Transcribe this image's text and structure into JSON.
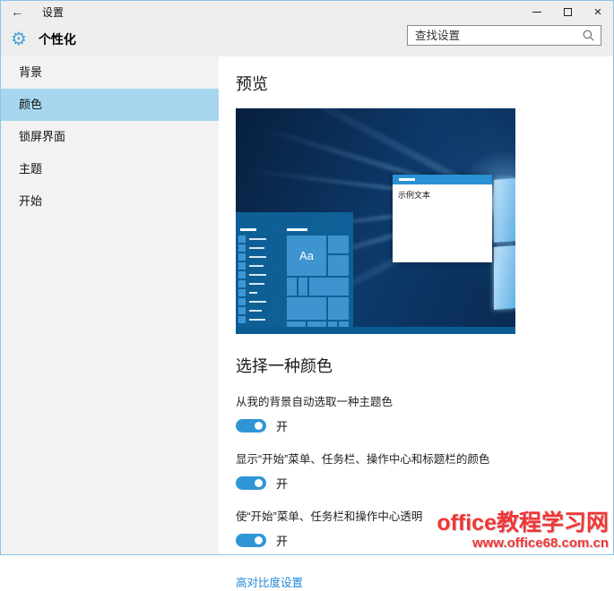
{
  "window": {
    "title": "设置",
    "back_icon": "←",
    "close_icon": "×"
  },
  "header": {
    "page_title": "个性化",
    "gear_icon": "⚙",
    "search_placeholder": "查找设置"
  },
  "sidebar": {
    "items": [
      {
        "label": "背景",
        "selected": false
      },
      {
        "label": "颜色",
        "selected": true
      },
      {
        "label": "锁屏界面",
        "selected": false
      },
      {
        "label": "主题",
        "selected": false
      },
      {
        "label": "开始",
        "selected": false
      }
    ]
  },
  "main": {
    "preview_heading": "预览",
    "preview": {
      "sample_window_text": "示例文本",
      "tile_label": "Aa"
    },
    "section_heading": "选择一种颜色",
    "toggles": [
      {
        "label": "从我的背景自动选取一种主题色",
        "state": "开",
        "on": true
      },
      {
        "label": "显示“开始”菜单、任务栏、操作中心和标题栏的颜色",
        "state": "开",
        "on": true
      },
      {
        "label": "使“开始”菜单、任务栏和操作中心透明",
        "state": "开",
        "on": true
      }
    ],
    "link_label": "高对比度设置"
  },
  "watermark": {
    "line1": "office教程学习网",
    "line2": "www.office68.com.cn"
  },
  "colors": {
    "accent_blue": "#2f95d6",
    "sidebar_selected": "#a6d7ef",
    "link_blue": "#2488d8",
    "watermark_red": "#f23435",
    "chrome_gray": "#eeeeee",
    "sidebar_gray": "#f2f2f2"
  }
}
